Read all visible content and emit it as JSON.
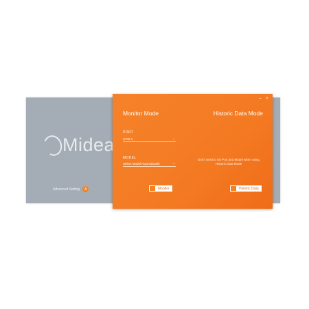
{
  "window": {
    "close_glyph": "×",
    "minimize_glyph": "–"
  },
  "left_panel": {
    "brand": "Midea",
    "advanced_setting": "Advanced Setting",
    "advanced_badge": "A"
  },
  "modes": {
    "monitor_mode": "Monitor Mode",
    "historic_mode": "Historic Data Mode"
  },
  "form": {
    "port_label": "PORT",
    "port_value": "COM 1",
    "model_label": "MODEL",
    "model_value": "Select Model Automatically"
  },
  "note": "Don't need to set Port and Model when using Historic Data Mode",
  "buttons": {
    "monitor_label": "Monitor",
    "historic_label": "Historic Data"
  },
  "colors": {
    "accent": "#f47a22",
    "back_panel": "#a4adb6"
  }
}
